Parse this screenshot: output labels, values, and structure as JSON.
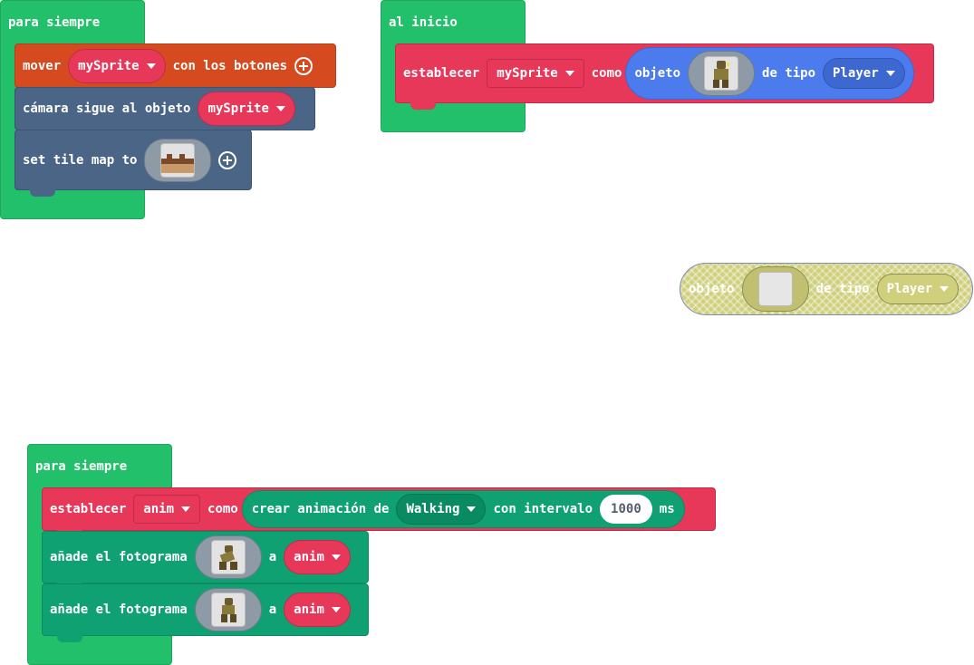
{
  "colors": {
    "event_green": "#23c06b",
    "controller_orange": "#d64a1f",
    "scene_slate": "#4a6586",
    "sprites_pink": "#e8385a",
    "sprite_blue": "#4b7bec",
    "animation_green": "#0fa172"
  },
  "forever_block_1": {
    "hat_label": "para siempre",
    "move_block": {
      "label": "mover",
      "sprite": "mySprite",
      "suffix": "con los botones"
    },
    "camera_block": {
      "label": "cámara sigue al objeto",
      "sprite": "mySprite"
    },
    "tilemap_block": {
      "label": "set tile map to"
    }
  },
  "on_start_block": {
    "hat_label": "al inicio",
    "set_block": {
      "label": "establecer",
      "variable": "mySprite",
      "connector": "como",
      "create_sprite": {
        "label": "objeto",
        "kind_label": "de tipo",
        "kind": "Player"
      }
    }
  },
  "floating_sprite_block": {
    "label": "objeto",
    "kind_label": "de tipo",
    "kind": "Player"
  },
  "forever_block_2": {
    "hat_label": "para siempre",
    "set_anim_block": {
      "label": "establecer",
      "variable": "anim",
      "connector": "como",
      "create_animation": {
        "label": "crear animación de",
        "action": "Walking",
        "interval_label": "con intervalo",
        "interval": "1000",
        "unit": "ms"
      }
    },
    "frame_blocks": [
      {
        "label": "añade el fotograma",
        "connector": "a",
        "variable": "anim"
      },
      {
        "label": "añade el fotograma",
        "connector": "a",
        "variable": "anim"
      }
    ]
  }
}
